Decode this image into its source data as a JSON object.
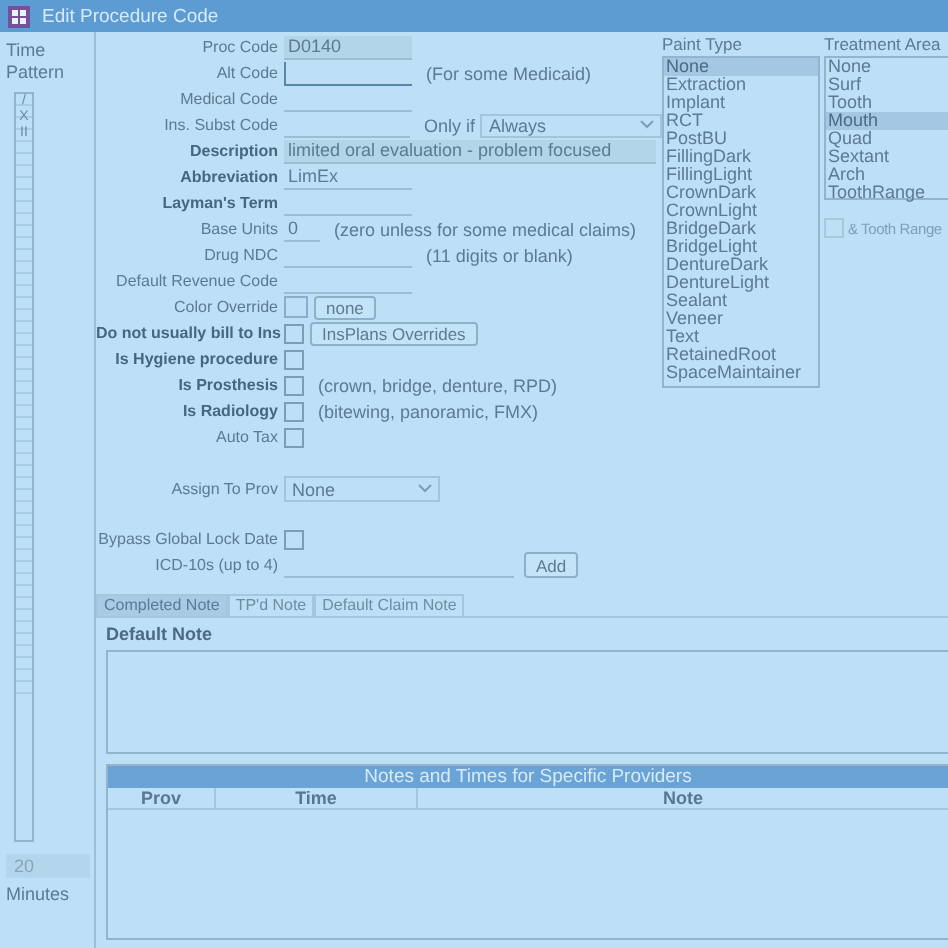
{
  "window": {
    "title": "Edit Procedure Code"
  },
  "time_pattern": {
    "label": "Time Pattern",
    "marks": [
      "/",
      "X",
      "II"
    ],
    "minutes": "20",
    "unit": "Minutes"
  },
  "form": {
    "rows": [
      {
        "kind": "text",
        "label": "Proc Code",
        "bold": false,
        "value": "D0140",
        "readonly": true
      },
      {
        "kind": "text",
        "label": "Alt Code",
        "bold": false,
        "focused": true,
        "note": "(For some Medicaid)"
      },
      {
        "kind": "text",
        "label": "Medical Code",
        "bold": false
      },
      {
        "kind": "text",
        "label": "Ins. Subst Code",
        "bold": false,
        "only_if": {
          "label": "Only if",
          "value": "Always"
        }
      },
      {
        "kind": "longtext",
        "label": "Description",
        "bold": true,
        "value": "limited oral evaluation - problem focused"
      },
      {
        "kind": "text",
        "label": "Abbreviation",
        "bold": true,
        "value": "LimEx"
      },
      {
        "kind": "text",
        "label": "Layman's Term",
        "bold": true
      },
      {
        "kind": "short",
        "label": "Base Units",
        "bold": false,
        "value": "0",
        "note": "(zero unless for some medical claims)"
      },
      {
        "kind": "text",
        "label": "Drug NDC",
        "bold": false,
        "note": "(11 digits or blank)"
      },
      {
        "kind": "text",
        "label": "Default Revenue Code",
        "bold": false
      },
      {
        "kind": "color",
        "label": "Color Override",
        "bold": false,
        "button": "none"
      },
      {
        "kind": "checkbox",
        "label": "Do not usually bill to Ins",
        "bold": true,
        "checked": false,
        "button": "InsPlans Overrides"
      },
      {
        "kind": "checkbox",
        "label": "Is Hygiene procedure",
        "bold": true,
        "checked": false
      },
      {
        "kind": "checkbox",
        "label": "Is Prosthesis",
        "bold": true,
        "checked": false,
        "note": "(crown, bridge, denture, RPD)"
      },
      {
        "kind": "checkbox",
        "label": "Is Radiology",
        "bold": true,
        "checked": false,
        "note": "(bitewing, panoramic, FMX)"
      },
      {
        "kind": "checkbox",
        "label": "Auto Tax",
        "bold": false,
        "checked": false
      }
    ],
    "assign_to_prov": {
      "label": "Assign To Prov",
      "value": "None"
    },
    "bypass_lock": {
      "label": "Bypass Global Lock Date",
      "checked": false
    },
    "icd10s": {
      "label": "ICD-10s (up to 4)",
      "button": "Add"
    }
  },
  "paint_type": {
    "label": "Paint Type",
    "items": [
      {
        "label": "None",
        "selected": true
      },
      {
        "label": "Extraction",
        "selected": false
      },
      {
        "label": "Implant",
        "selected": false
      },
      {
        "label": "RCT",
        "selected": false
      },
      {
        "label": "PostBU",
        "selected": false
      },
      {
        "label": "FillingDark",
        "selected": false
      },
      {
        "label": "FillingLight",
        "selected": false
      },
      {
        "label": "CrownDark",
        "selected": false
      },
      {
        "label": "CrownLight",
        "selected": false
      },
      {
        "label": "BridgeDark",
        "selected": false
      },
      {
        "label": "BridgeLight",
        "selected": false
      },
      {
        "label": "DentureDark",
        "selected": false
      },
      {
        "label": "DentureLight",
        "selected": false
      },
      {
        "label": "Sealant",
        "selected": false
      },
      {
        "label": "Veneer",
        "selected": false
      },
      {
        "label": "Text",
        "selected": false
      },
      {
        "label": "RetainedRoot",
        "selected": false
      },
      {
        "label": "SpaceMaintainer",
        "selected": false
      }
    ]
  },
  "treatment_area": {
    "label": "Treatment Area",
    "items": [
      {
        "label": "None",
        "selected": false
      },
      {
        "label": "Surf",
        "selected": false
      },
      {
        "label": "Tooth",
        "selected": false
      },
      {
        "label": "Mouth",
        "selected": true
      },
      {
        "label": "Quad",
        "selected": false
      },
      {
        "label": "Sextant",
        "selected": false
      },
      {
        "label": "Arch",
        "selected": false
      },
      {
        "label": "ToothRange",
        "selected": false
      }
    ],
    "tooth_range": {
      "label": "& Tooth Range",
      "checked": false,
      "disabled": true
    }
  },
  "tabs": [
    {
      "label": "Completed Note",
      "selected": true
    },
    {
      "label": "TP'd Note",
      "selected": false
    },
    {
      "label": "Default Claim Note",
      "selected": false
    }
  ],
  "note": {
    "label": "Default Note"
  },
  "providers_grid": {
    "title": "Notes and Times for Specific Providers",
    "columns": [
      "Prov",
      "Time",
      "Note"
    ]
  }
}
